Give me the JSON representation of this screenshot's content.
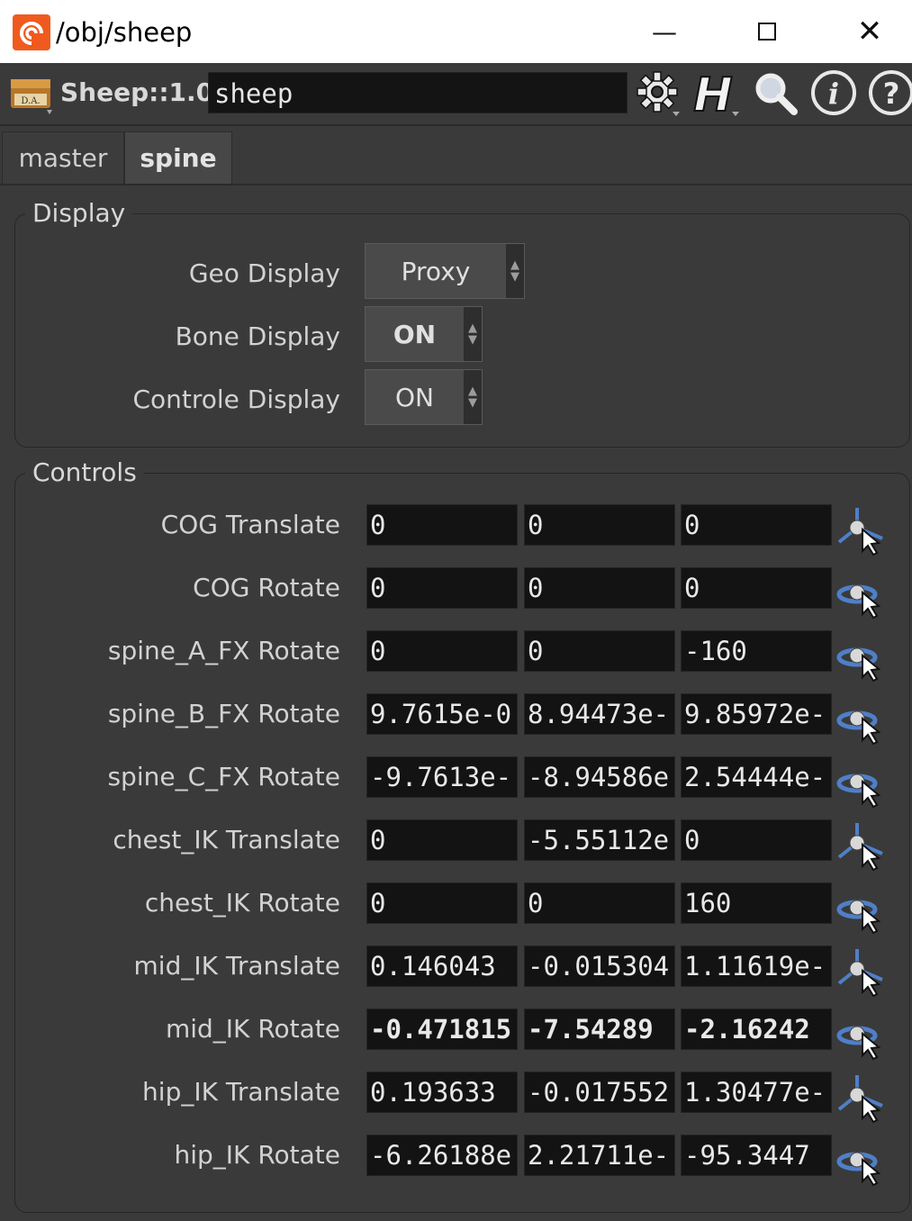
{
  "window": {
    "title": "/obj/sheep"
  },
  "operator": {
    "type": "Sheep::1.0",
    "name": "sheep"
  },
  "tabs": [
    {
      "label": "master"
    },
    {
      "label": "spine"
    }
  ],
  "display": {
    "title": "Display",
    "rows": [
      {
        "label": "Geo Display",
        "value": "Proxy"
      },
      {
        "label": "Bone Display",
        "value": "ON"
      },
      {
        "label": "Controle Display",
        "value": "ON"
      }
    ]
  },
  "controls": {
    "title": "Controls",
    "rows": [
      {
        "label": "COG Translate",
        "x": "0",
        "y": "0",
        "z": "0",
        "handle": "translate-handle-icon"
      },
      {
        "label": "COG Rotate",
        "x": "0",
        "y": "0",
        "z": "0",
        "handle": "rotate-handle-icon"
      },
      {
        "label": "spine_A_FX Rotate",
        "x": "0",
        "y": "0",
        "z": "-160",
        "handle": "rotate-handle-icon"
      },
      {
        "label": "spine_B_FX Rotate",
        "x": "9.7615e-0",
        "y": "8.94473e-",
        "z": "9.85972e-",
        "handle": "rotate-handle-icon"
      },
      {
        "label": "spine_C_FX Rotate",
        "x": "-9.7613e-",
        "y": "-8.94586e",
        "z": "2.54444e-",
        "handle": "rotate-handle-icon"
      },
      {
        "label": "chest_IK Translate",
        "x": "0",
        "y": "-5.55112e",
        "z": "0",
        "handle": "translate-handle-icon"
      },
      {
        "label": "chest_IK Rotate",
        "x": "0",
        "y": "0",
        "z": "160",
        "handle": "rotate-handle-icon"
      },
      {
        "label": "mid_IK Translate",
        "x": "0.146043",
        "y": "-0.015304",
        "z": "1.11619e-",
        "handle": "translate-handle-icon"
      },
      {
        "label": "mid_IK Rotate",
        "x": "-0.471815",
        "y": "-7.54289",
        "z": "-2.16242",
        "handle": "rotate-handle-icon"
      },
      {
        "label": "hip_IK Translate",
        "x": "0.193633",
        "y": "-0.017552",
        "z": "1.30477e-",
        "handle": "translate-handle-icon"
      },
      {
        "label": "hip_IK Rotate",
        "x": "-6.26188e",
        "y": "2.21711e-",
        "z": "-95.3447",
        "handle": "rotate-handle-icon"
      }
    ]
  },
  "colors": {
    "background": "#3a3a3a",
    "field": "#131313",
    "text": "#d2d2d2",
    "handle_blue": "#4f7fc8"
  }
}
